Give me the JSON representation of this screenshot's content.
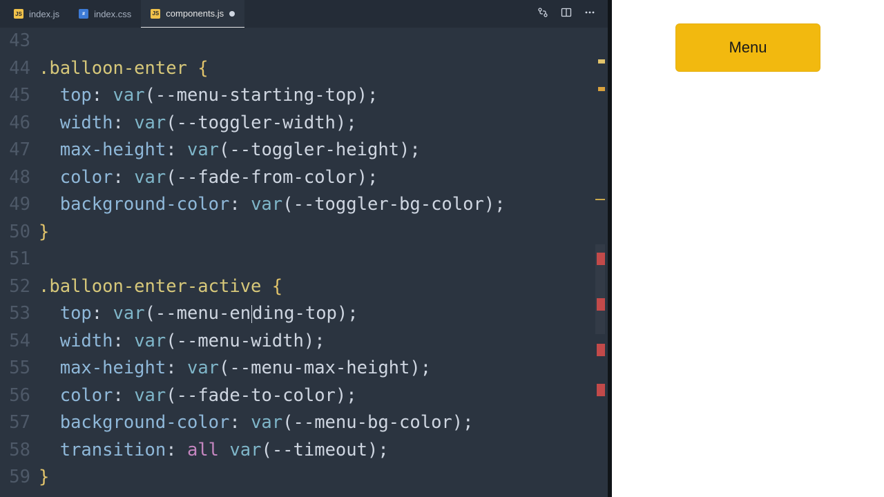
{
  "tabs": [
    {
      "label": "index.js",
      "icon": "JS",
      "iconClass": "js",
      "active": false,
      "dirty": false
    },
    {
      "label": "index.css",
      "icon": "#",
      "iconClass": "css",
      "active": false,
      "dirty": false
    },
    {
      "label": "components.js",
      "icon": "JS",
      "iconClass": "js",
      "active": true,
      "dirty": true
    }
  ],
  "editor": {
    "first_line_number": 43,
    "lines": [
      {
        "n": 43,
        "tokens": []
      },
      {
        "n": 44,
        "tokens": [
          {
            "t": ".balloon-enter",
            "c": "tok-selector"
          },
          {
            "t": " ",
            "c": ""
          },
          {
            "t": "{",
            "c": "tok-brace"
          }
        ]
      },
      {
        "n": 45,
        "tokens": [
          {
            "t": "  ",
            "c": ""
          },
          {
            "t": "top",
            "c": "tok-prop"
          },
          {
            "t": ": ",
            "c": "tok-punct"
          },
          {
            "t": "var",
            "c": "tok-func"
          },
          {
            "t": "(",
            "c": "tok-punct"
          },
          {
            "t": "--menu-starting-top",
            "c": "tok-var"
          },
          {
            "t": ")",
            "c": "tok-punct"
          },
          {
            "t": ";",
            "c": "tok-punct"
          }
        ]
      },
      {
        "n": 46,
        "tokens": [
          {
            "t": "  ",
            "c": ""
          },
          {
            "t": "width",
            "c": "tok-prop"
          },
          {
            "t": ": ",
            "c": "tok-punct"
          },
          {
            "t": "var",
            "c": "tok-func"
          },
          {
            "t": "(",
            "c": "tok-punct"
          },
          {
            "t": "--toggler-width",
            "c": "tok-var"
          },
          {
            "t": ")",
            "c": "tok-punct"
          },
          {
            "t": ";",
            "c": "tok-punct"
          }
        ]
      },
      {
        "n": 47,
        "tokens": [
          {
            "t": "  ",
            "c": ""
          },
          {
            "t": "max-height",
            "c": "tok-prop"
          },
          {
            "t": ": ",
            "c": "tok-punct"
          },
          {
            "t": "var",
            "c": "tok-func"
          },
          {
            "t": "(",
            "c": "tok-punct"
          },
          {
            "t": "--toggler-height",
            "c": "tok-var"
          },
          {
            "t": ")",
            "c": "tok-punct"
          },
          {
            "t": ";",
            "c": "tok-punct"
          }
        ]
      },
      {
        "n": 48,
        "tokens": [
          {
            "t": "  ",
            "c": ""
          },
          {
            "t": "color",
            "c": "tok-prop"
          },
          {
            "t": ": ",
            "c": "tok-punct"
          },
          {
            "t": "var",
            "c": "tok-func"
          },
          {
            "t": "(",
            "c": "tok-punct"
          },
          {
            "t": "--fade-from-color",
            "c": "tok-var"
          },
          {
            "t": ")",
            "c": "tok-punct"
          },
          {
            "t": ";",
            "c": "tok-punct"
          }
        ]
      },
      {
        "n": 49,
        "tokens": [
          {
            "t": "  ",
            "c": ""
          },
          {
            "t": "background-color",
            "c": "tok-prop"
          },
          {
            "t": ": ",
            "c": "tok-punct"
          },
          {
            "t": "var",
            "c": "tok-func"
          },
          {
            "t": "(",
            "c": "tok-punct"
          },
          {
            "t": "--toggler-bg-color",
            "c": "tok-var"
          },
          {
            "t": ")",
            "c": "tok-punct"
          },
          {
            "t": ";",
            "c": "tok-punct"
          }
        ]
      },
      {
        "n": 50,
        "tokens": [
          {
            "t": "}",
            "c": "tok-brace"
          }
        ]
      },
      {
        "n": 51,
        "tokens": []
      },
      {
        "n": 52,
        "tokens": [
          {
            "t": ".balloon-enter-active",
            "c": "tok-selector"
          },
          {
            "t": " ",
            "c": ""
          },
          {
            "t": "{",
            "c": "tok-brace"
          }
        ]
      },
      {
        "n": 53,
        "tokens": [
          {
            "t": "  ",
            "c": ""
          },
          {
            "t": "top",
            "c": "tok-prop"
          },
          {
            "t": ": ",
            "c": "tok-punct"
          },
          {
            "t": "var",
            "c": "tok-func"
          },
          {
            "t": "(",
            "c": "tok-punct"
          },
          {
            "t": "--menu-ending-top",
            "c": "tok-var",
            "cursor": true
          },
          {
            "t": ")",
            "c": "tok-punct"
          },
          {
            "t": ";",
            "c": "tok-punct"
          }
        ]
      },
      {
        "n": 54,
        "tokens": [
          {
            "t": "  ",
            "c": ""
          },
          {
            "t": "width",
            "c": "tok-prop"
          },
          {
            "t": ": ",
            "c": "tok-punct"
          },
          {
            "t": "var",
            "c": "tok-func"
          },
          {
            "t": "(",
            "c": "tok-punct"
          },
          {
            "t": "--menu-width",
            "c": "tok-var"
          },
          {
            "t": ")",
            "c": "tok-punct"
          },
          {
            "t": ";",
            "c": "tok-punct"
          }
        ]
      },
      {
        "n": 55,
        "tokens": [
          {
            "t": "  ",
            "c": ""
          },
          {
            "t": "max-height",
            "c": "tok-prop"
          },
          {
            "t": ": ",
            "c": "tok-punct"
          },
          {
            "t": "var",
            "c": "tok-func"
          },
          {
            "t": "(",
            "c": "tok-punct"
          },
          {
            "t": "--menu-max-height",
            "c": "tok-var"
          },
          {
            "t": ")",
            "c": "tok-punct"
          },
          {
            "t": ";",
            "c": "tok-punct"
          }
        ]
      },
      {
        "n": 56,
        "tokens": [
          {
            "t": "  ",
            "c": ""
          },
          {
            "t": "color",
            "c": "tok-prop"
          },
          {
            "t": ": ",
            "c": "tok-punct"
          },
          {
            "t": "var",
            "c": "tok-func"
          },
          {
            "t": "(",
            "c": "tok-punct"
          },
          {
            "t": "--fade-to-color",
            "c": "tok-var"
          },
          {
            "t": ")",
            "c": "tok-punct"
          },
          {
            "t": ";",
            "c": "tok-punct"
          }
        ]
      },
      {
        "n": 57,
        "tokens": [
          {
            "t": "  ",
            "c": ""
          },
          {
            "t": "background-color",
            "c": "tok-prop"
          },
          {
            "t": ": ",
            "c": "tok-punct"
          },
          {
            "t": "var",
            "c": "tok-func"
          },
          {
            "t": "(",
            "c": "tok-punct"
          },
          {
            "t": "--menu-bg-color",
            "c": "tok-var"
          },
          {
            "t": ")",
            "c": "tok-punct"
          },
          {
            "t": ";",
            "c": "tok-punct"
          }
        ]
      },
      {
        "n": 58,
        "tokens": [
          {
            "t": "  ",
            "c": ""
          },
          {
            "t": "transition",
            "c": "tok-prop"
          },
          {
            "t": ": ",
            "c": "tok-punct"
          },
          {
            "t": "all",
            "c": "tok-kw"
          },
          {
            "t": " ",
            "c": ""
          },
          {
            "t": "var",
            "c": "tok-func"
          },
          {
            "t": "(",
            "c": "tok-punct"
          },
          {
            "t": "--timeout",
            "c": "tok-var"
          },
          {
            "t": ")",
            "c": "tok-punct"
          },
          {
            "t": ";",
            "c": "tok-punct"
          }
        ]
      },
      {
        "n": 59,
        "tokens": [
          {
            "t": "}",
            "c": "tok-brace"
          }
        ]
      }
    ]
  },
  "preview": {
    "menu_button_label": "Menu"
  }
}
